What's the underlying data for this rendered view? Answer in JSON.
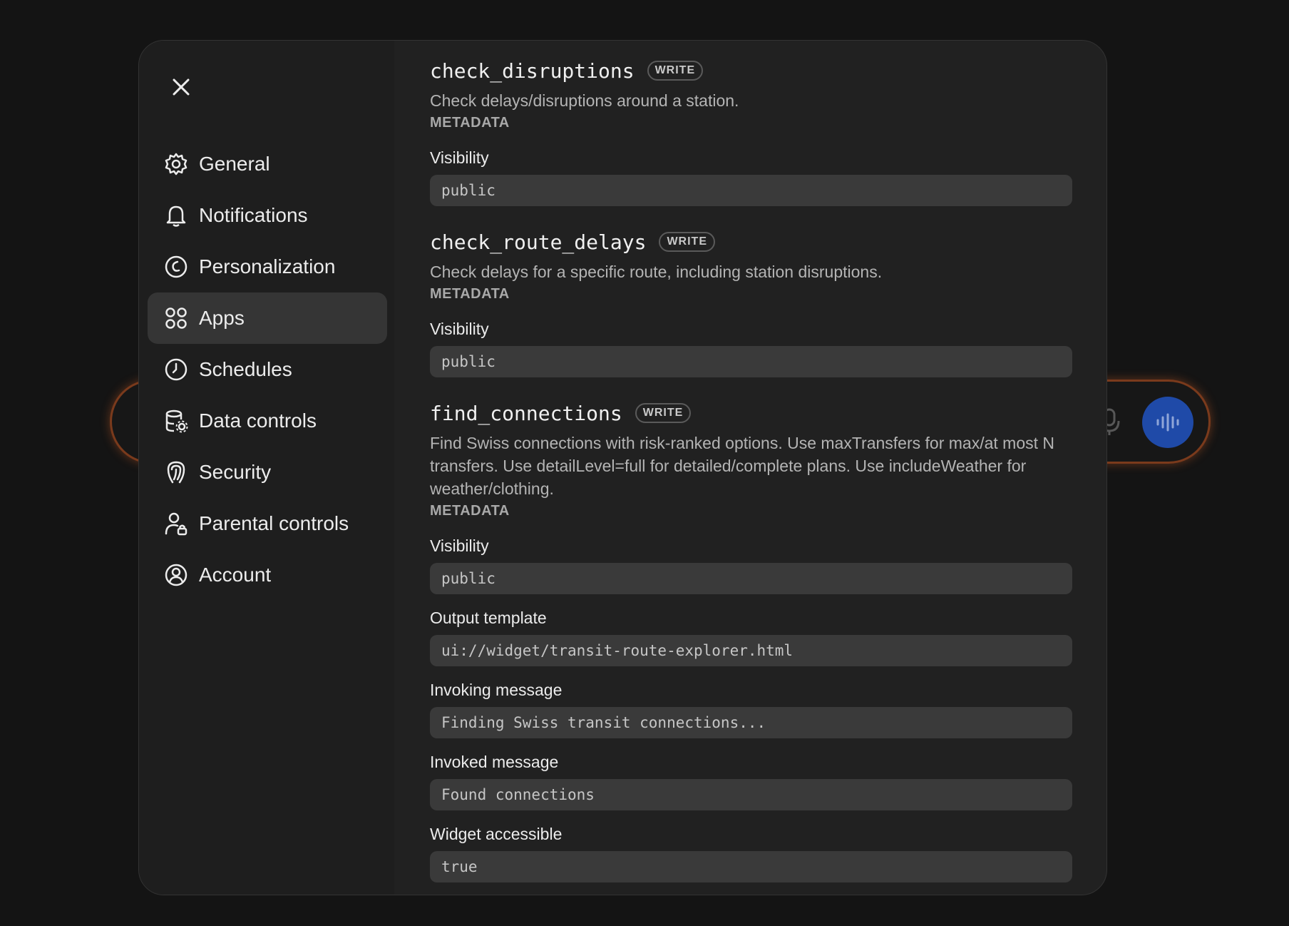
{
  "sidebar": {
    "items": [
      {
        "label": "General",
        "icon": "gear-icon"
      },
      {
        "label": "Notifications",
        "icon": "bell-icon"
      },
      {
        "label": "Personalization",
        "icon": "personalization-icon"
      },
      {
        "label": "Apps",
        "icon": "apps-grid-icon",
        "active": true
      },
      {
        "label": "Schedules",
        "icon": "clock-icon"
      },
      {
        "label": "Data controls",
        "icon": "database-gear-icon"
      },
      {
        "label": "Security",
        "icon": "shield-icon"
      },
      {
        "label": "Parental controls",
        "icon": "user-lock-icon"
      },
      {
        "label": "Account",
        "icon": "user-circle-icon"
      }
    ]
  },
  "tools": [
    {
      "name": "check_disruptions",
      "badge": "WRITE",
      "description": "Check delays/disruptions around a station.",
      "metadata_label": "METADATA",
      "fields": [
        {
          "label": "Visibility",
          "value": "public"
        }
      ]
    },
    {
      "name": "check_route_delays",
      "badge": "WRITE",
      "description": "Check delays for a specific route, including station disruptions.",
      "metadata_label": "METADATA",
      "fields": [
        {
          "label": "Visibility",
          "value": "public"
        }
      ]
    },
    {
      "name": "find_connections",
      "badge": "WRITE",
      "description": "Find Swiss connections with risk-ranked options. Use maxTransfers for max/at most N transfers. Use detailLevel=full for detailed/complete plans. Use includeWeather for weather/clothing.",
      "metadata_label": "METADATA",
      "fields": [
        {
          "label": "Visibility",
          "value": "public"
        },
        {
          "label": "Output template",
          "value": "ui://widget/transit-route-explorer.html"
        },
        {
          "label": "Invoking message",
          "value": "Finding Swiss transit connections..."
        },
        {
          "label": "Invoked message",
          "value": "Found connections"
        },
        {
          "label": "Widget accessible",
          "value": "true"
        }
      ]
    }
  ],
  "colors": {
    "modal_bg": "#212121",
    "sidebar_bg": "#1e1e1e",
    "active_bg": "#353535",
    "field_bg": "#3a3a3a",
    "voice_button": "#1f4aa8",
    "composer_glow": "#c45c26"
  }
}
